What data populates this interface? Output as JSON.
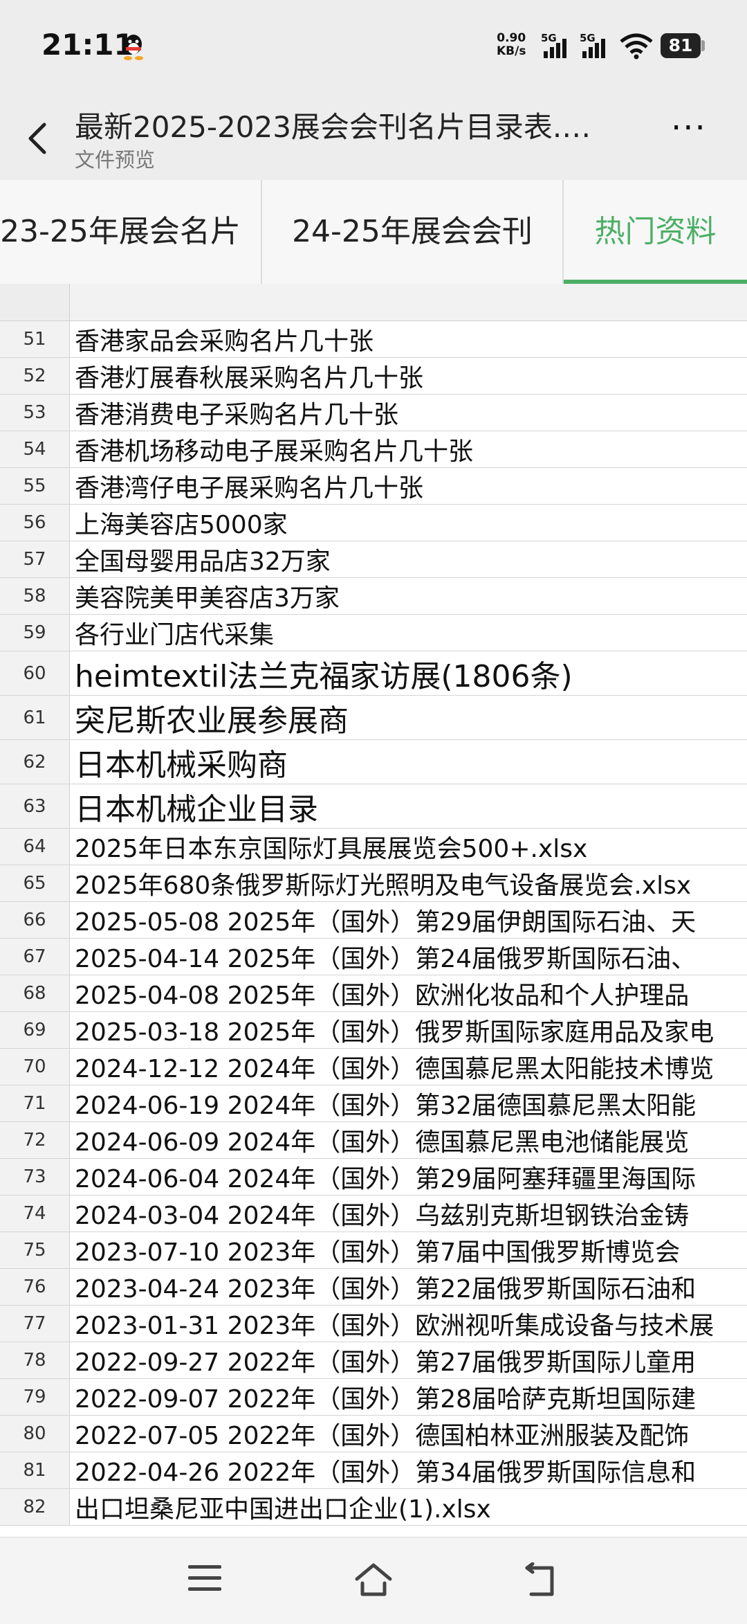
{
  "status_bar": {
    "time": "21:11",
    "speed_value": "0.90",
    "speed_unit": "KB/s",
    "sim1": "5G",
    "sim2": "5G",
    "battery": "81",
    "icons": [
      "qq-icon",
      "signal-icon",
      "wifi-icon",
      "battery-icon"
    ]
  },
  "title_bar": {
    "title": "最新2025-2023展会会刊名片目录表.…",
    "subtitle": "文件预览",
    "back_icon": "back-arrow-icon",
    "more_label": "···"
  },
  "tabs": [
    {
      "label": "23-25年展会名片"
    },
    {
      "label": "24-25年展会会刊"
    },
    {
      "label": "热门资料"
    }
  ],
  "active_tab": 2,
  "accent_color": "#4caf67",
  "rows": [
    {
      "num": "51",
      "text": "香港家品会采购名片几十张"
    },
    {
      "num": "52",
      "text": "香港灯展春秋展采购名片几十张"
    },
    {
      "num": "53",
      "text": "香港消费电子采购名片几十张"
    },
    {
      "num": "54",
      "text": "香港机场移动电子展采购名片几十张"
    },
    {
      "num": "55",
      "text": "香港湾仔电子展采购名片几十张"
    },
    {
      "num": "56",
      "text": "上海美容店5000家"
    },
    {
      "num": "57",
      "text": "全国母婴用品店32万家"
    },
    {
      "num": "58",
      "text": "美容院美甲美容店3万家"
    },
    {
      "num": "59",
      "text": "各行业门店代采集"
    },
    {
      "num": "60",
      "text": "heimtextil法兰克福家访展(1806条)"
    },
    {
      "num": "61",
      "text": "突尼斯农业展参展商"
    },
    {
      "num": "62",
      "text": "日本机械采购商"
    },
    {
      "num": "63",
      "text": "日本机械企业目录"
    },
    {
      "num": "64",
      "text": "2025年日本东京国际灯具展展览会500+.xlsx"
    },
    {
      "num": "65",
      "text": "2025年680条俄罗斯际灯光照明及电气设备展览会.xlsx"
    },
    {
      "num": "66",
      "text": "2025-05-08  2025年（国外）第29届伊朗国际石油、天"
    },
    {
      "num": "67",
      "text": "2025-04-14  2025年（国外）第24届俄罗斯国际石油、"
    },
    {
      "num": "68",
      "text": "2025-04-08  2025年（国外）欧洲化妆品和个人护理品"
    },
    {
      "num": "69",
      "text": "2025-03-18  2025年（国外）俄罗斯国际家庭用品及家电"
    },
    {
      "num": "70",
      "text": "2024-12-12  2024年（国外）德国慕尼黑太阳能技术博览"
    },
    {
      "num": "71",
      "text": "2024-06-19  2024年（国外）第32届德国慕尼黑太阳能"
    },
    {
      "num": "72",
      "text": "2024-06-09  2024年（国外）德国慕尼黑电池储能展览"
    },
    {
      "num": "73",
      "text": "2024-06-04  2024年（国外）第29届阿塞拜疆里海国际"
    },
    {
      "num": "74",
      "text": "2024-03-04  2024年（国外）乌兹别克斯坦钢铁治金铸"
    },
    {
      "num": "75",
      "text": "2023-07-10  2023年（国外）第7届中国俄罗斯博览会"
    },
    {
      "num": "76",
      "text": "2023-04-24  2023年（国外）第22届俄罗斯国际石油和"
    },
    {
      "num": "77",
      "text": "2023-01-31  2023年（国外）欧洲视听集成设备与技术展"
    },
    {
      "num": "78",
      "text": "2022-09-27  2022年（国外）第27届俄罗斯国际儿童用"
    },
    {
      "num": "79",
      "text": "2022-09-07  2022年（国外）第28届哈萨克斯坦国际建"
    },
    {
      "num": "80",
      "text": "2022-07-05  2022年（国外）德国柏林亚洲服装及配饰"
    },
    {
      "num": "81",
      "text": "2022-04-26  2022年（国外）第34届俄罗斯国际信息和"
    },
    {
      "num": "82",
      "text": "出口坦桑尼亚中国进出口企业(1).xlsx"
    }
  ],
  "nav_bar": {
    "icons": [
      "menu-icon",
      "home-icon",
      "back-icon"
    ]
  }
}
